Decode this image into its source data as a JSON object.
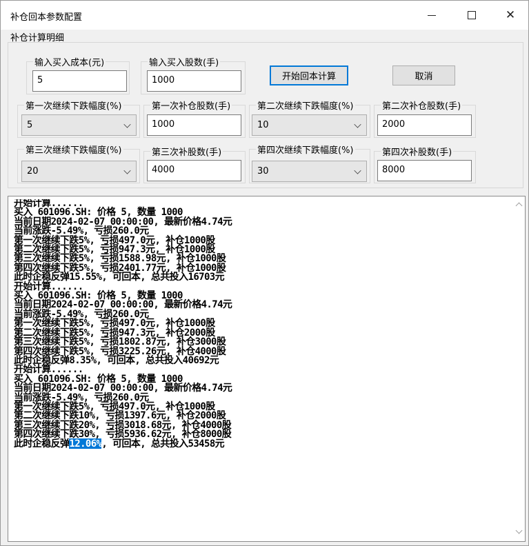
{
  "window": {
    "title": "补仓回本参数配置",
    "min_label": "",
    "max_label": "",
    "close_label": "✕"
  },
  "group": {
    "label": "补仓计算明细"
  },
  "fields": {
    "cost": {
      "label": "输入买入成本(元)",
      "value": "5"
    },
    "shares": {
      "label": "输入买入股数(手)",
      "value": "1000"
    },
    "drop1": {
      "label": "第一次继续下跌幅度(%)",
      "value": "5"
    },
    "add1": {
      "label": "第一次补仓股数(手)",
      "value": "1000"
    },
    "drop2": {
      "label": "第二次继续下跌幅度(%)",
      "value": "10"
    },
    "add2": {
      "label": "第二次补仓股数(手)",
      "value": "2000"
    },
    "drop3": {
      "label": "第三次继续下跌幅度(%)",
      "value": "20"
    },
    "add3": {
      "label": "第三次补股数(手)",
      "value": "4000"
    },
    "drop4": {
      "label": "第四次继续下跌幅度(%)",
      "value": "30"
    },
    "add4": {
      "label": "第四次补股数(手)",
      "value": "8000"
    }
  },
  "buttons": {
    "start": "开始回本计算",
    "cancel": "取消"
  },
  "output": {
    "lines": [
      "开始计算......",
      "买入 601096.SH: 价格 5, 数量 1000",
      "当前日期2024-02-07 00:00:00, 最新价格4.74元",
      "当前涨跌-5.49%, 亏损260.0元",
      "第一次继续下跌5%, 亏损497.0元, 补仓1000股",
      "第二次继续下跌5%, 亏损947.3元, 补仓1000股",
      "第三次继续下跌5%, 亏损1588.98元, 补仓1000股",
      "第四次继续下跌5%, 亏损2401.77元, 补仓1000股",
      "此时企稳反弹15.55%, 可回本, 总共投入16703元",
      "开始计算......",
      "买入 601096.SH: 价格 5, 数量 1000",
      "当前日期2024-02-07 00:00:00, 最新价格4.74元",
      "当前涨跌-5.49%, 亏损260.0元",
      "第一次继续下跌5%, 亏损497.0元, 补仓1000股",
      "第二次继续下跌5%, 亏损947.3元, 补仓2000股",
      "第三次继续下跌5%, 亏损1802.87元, 补仓3000股",
      "第四次继续下跌5%, 亏损3225.26元, 补仓4000股",
      "此时企稳反弹8.35%, 可回本, 总共投入40692元",
      "开始计算......",
      "买入 601096.SH: 价格 5, 数量 1000",
      "当前日期2024-02-07 00:00:00, 最新价格4.74元",
      "当前涨跌-5.49%, 亏损260.0元",
      "第一次继续下跌5%, 亏损497.0元, 补仓1000股",
      "第二次继续下跌10%, 亏损1397.6元, 补仓2000股",
      "第三次继续下跌20%, 亏损3018.68元, 补仓4000股",
      "第四次继续下跌30%, 亏损5936.62元, 补仓8000股"
    ],
    "last_prefix": "此时企稳反弹",
    "last_selected": "12.06%",
    "last_suffix": ", 可回本, 总共投入53458元"
  }
}
